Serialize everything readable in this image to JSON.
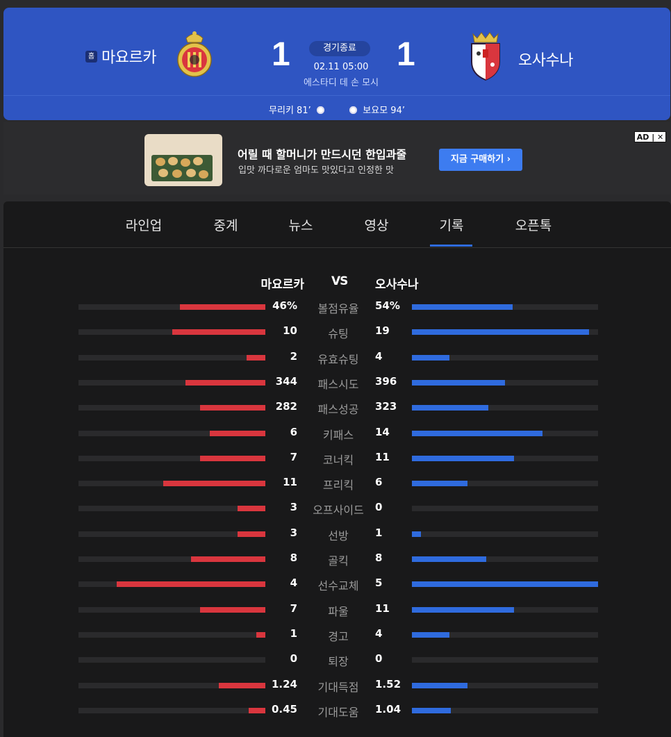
{
  "match": {
    "home_badge": "홈",
    "home_team": "마요르카",
    "away_team": "오사수나",
    "home_score": "1",
    "away_score": "1",
    "status": "경기종료",
    "datetime": "02.11 05:00",
    "stadium": "에스타디 데 손 모시",
    "home_scorer": "무리키 81’",
    "away_scorer": "보요모 94’"
  },
  "ad": {
    "title": "어릴 때 할머니가 만드시던 한입과줄",
    "subtitle": "입맛 까다로운 엄마도 맛있다고 인정한 맛",
    "cta": "지금 구매하기 ›",
    "label": "AD | ✕"
  },
  "tabs": [
    {
      "label": "라인업",
      "active": false
    },
    {
      "label": "중계",
      "active": false
    },
    {
      "label": "뉴스",
      "active": false
    },
    {
      "label": "영상",
      "active": false
    },
    {
      "label": "기록",
      "active": true
    },
    {
      "label": "오픈톡",
      "active": false
    }
  ],
  "stats_header": {
    "home": "마요르카",
    "vs": "VS",
    "away": "오사수나"
  },
  "stats": [
    {
      "label": "볼점유율",
      "home": "46%",
      "away": "54%",
      "home_ratio": 0.46,
      "away_ratio": 0.54
    },
    {
      "label": "슈팅",
      "home": "10",
      "away": "19",
      "home_ratio": 0.5,
      "away_ratio": 0.95
    },
    {
      "label": "유효슈팅",
      "home": "2",
      "away": "4",
      "home_ratio": 0.1,
      "away_ratio": 0.2
    },
    {
      "label": "패스시도",
      "home": "344",
      "away": "396",
      "home_ratio": 0.43,
      "away_ratio": 0.5
    },
    {
      "label": "패스성공",
      "home": "282",
      "away": "323",
      "home_ratio": 0.35,
      "away_ratio": 0.41
    },
    {
      "label": "키패스",
      "home": "6",
      "away": "14",
      "home_ratio": 0.3,
      "away_ratio": 0.7
    },
    {
      "label": "코너킥",
      "home": "7",
      "away": "11",
      "home_ratio": 0.35,
      "away_ratio": 0.55
    },
    {
      "label": "프리킥",
      "home": "11",
      "away": "6",
      "home_ratio": 0.55,
      "away_ratio": 0.3
    },
    {
      "label": "오프사이드",
      "home": "3",
      "away": "0",
      "home_ratio": 0.15,
      "away_ratio": 0.0
    },
    {
      "label": "선방",
      "home": "3",
      "away": "1",
      "home_ratio": 0.15,
      "away_ratio": 0.05
    },
    {
      "label": "골킥",
      "home": "8",
      "away": "8",
      "home_ratio": 0.4,
      "away_ratio": 0.4
    },
    {
      "label": "선수교체",
      "home": "4",
      "away": "5",
      "home_ratio": 0.8,
      "away_ratio": 1.0
    },
    {
      "label": "파울",
      "home": "7",
      "away": "11",
      "home_ratio": 0.35,
      "away_ratio": 0.55
    },
    {
      "label": "경고",
      "home": "1",
      "away": "4",
      "home_ratio": 0.05,
      "away_ratio": 0.2
    },
    {
      "label": "퇴장",
      "home": "0",
      "away": "0",
      "home_ratio": 0.0,
      "away_ratio": 0.0
    },
    {
      "label": "기대득점",
      "home": "1.24",
      "away": "1.52",
      "home_ratio": 0.25,
      "away_ratio": 0.3
    },
    {
      "label": "기대도움",
      "home": "0.45",
      "away": "1.04",
      "home_ratio": 0.09,
      "away_ratio": 0.21
    }
  ],
  "colors": {
    "header_bg": "#2f55c2",
    "home_bar": "#d9363e",
    "away_bar": "#2f6bde",
    "panel_bg": "#19191a"
  }
}
